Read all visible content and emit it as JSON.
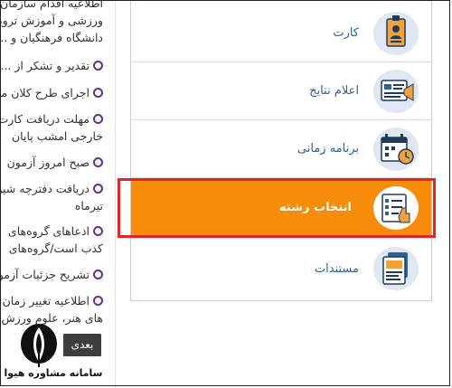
{
  "news": {
    "items": [
      "اطلاعیه اقدام سازمان",
      "ورزشی و آموزش ترویج",
      "دانشگاه فرهنگیان و ...",
      "تقدیر و تشکر از ...",
      "اجرای طرح کلان ملی",
      "مهلت دریافت کارت",
      "خارجی امشب پایان",
      "صبح امروز آزمون",
      "دریافت دفترچه شیوه",
      "تیرماه",
      "ادعاهای گروه‌های",
      "کذب است/گروه‌های",
      "تشریح جزئیات آزمون",
      "اطلاعیه تغییر زمان",
      "های هنر، علوم ورزش"
    ],
    "next_label": "بعدی"
  },
  "logo": {
    "text": "سامانه مشاوره هیوا"
  },
  "menu": {
    "items": [
      {
        "label": "کارت",
        "icon": "id-card-icon"
      },
      {
        "label": "اعلام نتایج",
        "icon": "results-announcement-icon"
      },
      {
        "label": "برنامه زمانی",
        "icon": "calendar-clock-icon"
      },
      {
        "label": "انتخاب رشته",
        "icon": "field-selection-checklist-icon"
      },
      {
        "label": "مستندات",
        "icon": "documents-icon"
      }
    ]
  },
  "colors": {
    "accent_orange": "#f78c0a",
    "highlight_red": "#e3242b",
    "link_blue": "#2a6496",
    "bullet_purple": "#6a2c8f"
  }
}
